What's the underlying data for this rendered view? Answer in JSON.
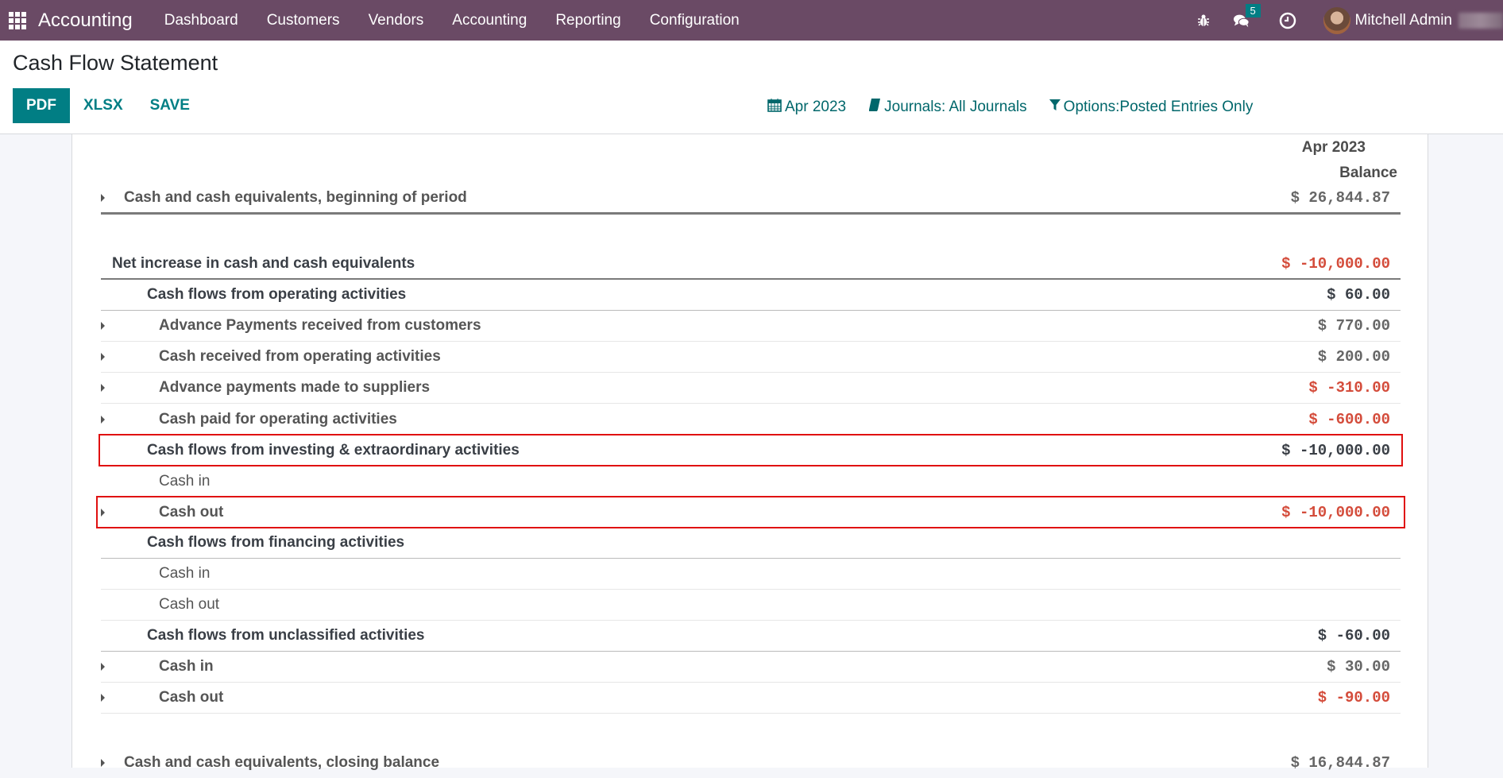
{
  "navbar": {
    "app_name": "Accounting",
    "menu": [
      "Dashboard",
      "Customers",
      "Vendors",
      "Accounting",
      "Reporting",
      "Configuration"
    ],
    "messages_badge": "5",
    "user_name": "Mitchell Admin"
  },
  "control_panel": {
    "title": "Cash Flow Statement",
    "buttons": {
      "pdf": "PDF",
      "xlsx": "XLSX",
      "save": "SAVE"
    },
    "filters": {
      "date": "Apr 2023",
      "journals": "Journals: All Journals",
      "options": "Options:Posted Entries Only"
    }
  },
  "report": {
    "column_date": "Apr 2023",
    "column_label": "Balance",
    "colors": {
      "negative": "#d44c3b",
      "highlight": "#e01010",
      "accent": "#017e84"
    },
    "beginning": {
      "label": "Cash and cash equivalents, beginning of period",
      "amount": "$ 26,844.87"
    },
    "net_increase": {
      "label": "Net increase in cash and cash equivalents",
      "amount": "$ -10,000.00"
    },
    "operating": {
      "label": "Cash flows from operating activities",
      "amount": "$ 60.00",
      "lines": [
        {
          "label": "Advance Payments received from customers",
          "amount": "$ 770.00"
        },
        {
          "label": "Cash received from operating activities",
          "amount": "$ 200.00"
        },
        {
          "label": "Advance payments made to suppliers",
          "amount": "$ -310.00"
        },
        {
          "label": "Cash paid for operating activities",
          "amount": "$ -600.00"
        }
      ]
    },
    "investing": {
      "label": "Cash flows from investing & extraordinary activities",
      "amount": "$ -10,000.00",
      "cash_in": {
        "label": "Cash in",
        "amount": ""
      },
      "cash_out": {
        "label": "Cash out",
        "amount": "$ -10,000.00"
      }
    },
    "financing": {
      "label": "Cash flows from financing activities",
      "amount": "",
      "cash_in": {
        "label": "Cash in",
        "amount": ""
      },
      "cash_out": {
        "label": "Cash out",
        "amount": ""
      }
    },
    "unclassified": {
      "label": "Cash flows from unclassified activities",
      "amount": "$ -60.00",
      "cash_in": {
        "label": "Cash in",
        "amount": "$ 30.00"
      },
      "cash_out": {
        "label": "Cash out",
        "amount": "$ -90.00"
      }
    },
    "closing": {
      "label": "Cash and cash equivalents, closing balance",
      "amount": "$ 16,844.87"
    }
  }
}
